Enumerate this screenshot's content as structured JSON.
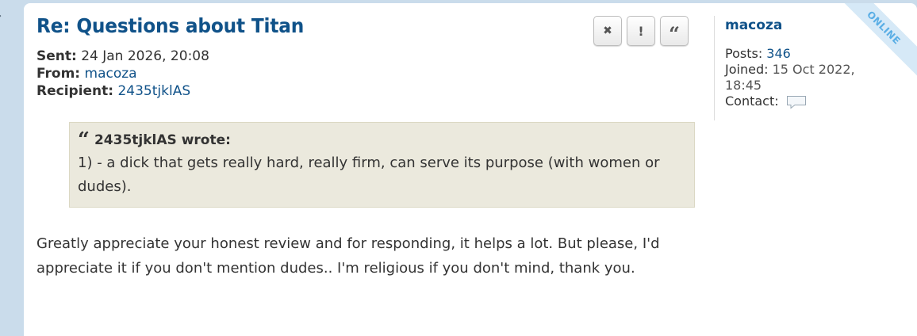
{
  "post": {
    "title": "Re: Questions about Titan",
    "sent_label": "Sent:",
    "sent_value": "24 Jan 2026, 20:08",
    "from_label": "From:",
    "from_value": "macoza",
    "recipient_label": "Recipient:",
    "recipient_value": "2435tjklAS",
    "quote": {
      "author_line": "2435tjklAS wrote:",
      "text": "1) - a dick that gets really hard, really firm, can serve its purpose (with women or dudes)."
    },
    "body": "Greatly appreciate your honest review and for responding, it helps a lot. But please, I'd appreciate it if you don't mention dudes.. I'm religious if you don't mind, thank you."
  },
  "actions": {
    "delete_glyph": "✖",
    "report_glyph": "!",
    "quote_glyph": "“"
  },
  "profile": {
    "username": "macoza",
    "posts_label": "Posts:",
    "posts_value": "346",
    "joined_label": "Joined:",
    "joined_value": "15 Oct 2022, 18:45",
    "contact_label": "Contact:",
    "status_badge": "ONLINE"
  },
  "colors": {
    "link": "#105289",
    "quote_bg": "#ebe9dd",
    "online_badge": "#5aaee5",
    "page_bg": "#cadceb"
  },
  "icons": [
    "delete-icon",
    "report-icon",
    "quote-icon",
    "contact-icon"
  ]
}
